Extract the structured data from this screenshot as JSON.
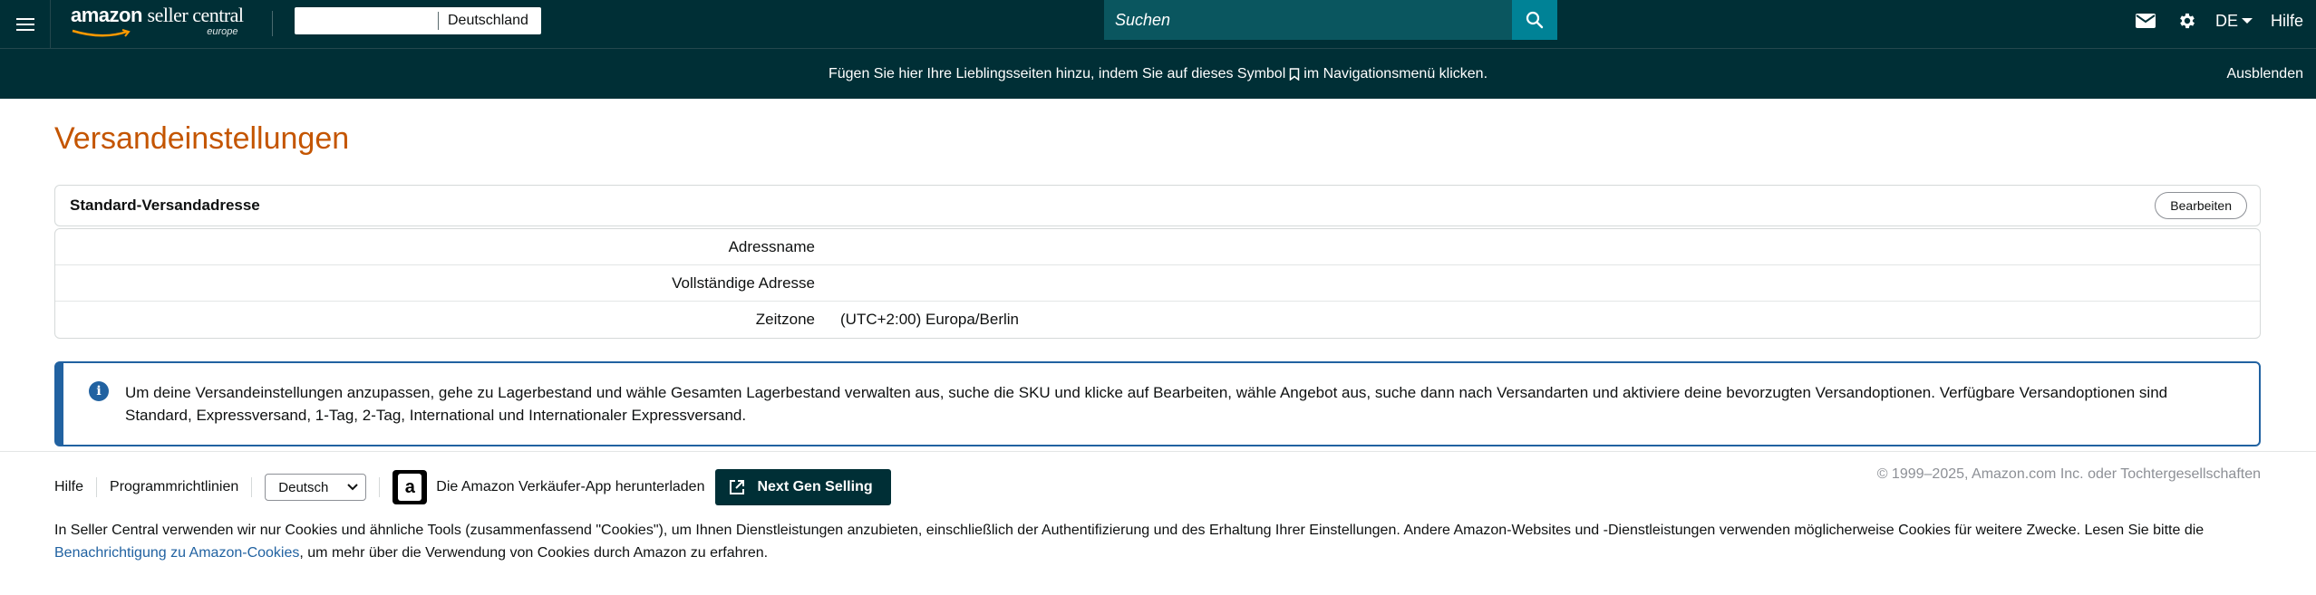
{
  "header": {
    "logo_main": "amazon",
    "logo_rest": "seller central",
    "logo_sub": "europe",
    "marketplace": "Deutschland",
    "search_placeholder": "Suchen",
    "language": "DE",
    "help": "Hilfe"
  },
  "favbar": {
    "message_before": "Fügen Sie hier Ihre Lieblingsseiten hinzu, indem Sie auf dieses Symbol",
    "message_after": "im Navigationsmenü klicken.",
    "hide": "Ausblenden"
  },
  "page": {
    "title": "Versandeinstellungen",
    "card_title": "Standard-Versandadresse",
    "edit_button": "Bearbeiten",
    "rows": [
      {
        "label": "Adressname",
        "value": ""
      },
      {
        "label": "Vollständige Adresse",
        "value": ""
      },
      {
        "label": "Zeitzone",
        "value": "(UTC+2:00) Europa/Berlin"
      }
    ],
    "info": "Um deine Versandeinstellungen anzupassen, gehe zu Lagerbestand und wähle Gesamten Lagerbestand verwalten aus, suche die SKU und klicke auf Bearbeiten, wähle Angebot aus, suche dann nach Versandarten und aktiviere deine bevorzugten Versandoptionen. Verfügbare Versandoptionen sind Standard, Expressversand, 1-Tag, 2-Tag, International und Internationaler Expressversand."
  },
  "footer": {
    "help": "Hilfe",
    "policies": "Programmrichtlinien",
    "language_select": "Deutsch",
    "app_download": "Die Amazon Verkäufer-App herunterladen",
    "next_gen": "Next Gen Selling",
    "copyright": "© 1999–2025, Amazon.com Inc. oder Tochtergesellschaften",
    "cookie_before": "In Seller Central verwenden wir nur Cookies und ähnliche Tools (zusammenfassend \"Cookies\"), um Ihnen Dienstleistungen anzubieten, einschließlich der Authentifizierung und des Erhaltung Ihrer Einstellungen. Andere Amazon-Websites und -Dienstleistungen verwenden möglicherweise Cookies für weitere Zwecke. Lesen Sie bitte die",
    "cookie_link": "Benachrichtigung zu Amazon-Cookies",
    "cookie_after": ", um mehr über die Verwendung von Cookies durch Amazon zu erfahren."
  },
  "colors": {
    "nav_bg": "#002f36",
    "title": "#c45500",
    "info_border": "#2162a1",
    "link": "#2162a1"
  },
  "icons": {
    "menu": "hamburger-icon",
    "search": "search-icon",
    "mail": "mail-icon",
    "settings": "gear-icon",
    "bookmark": "bookmark-icon",
    "info": "info-icon",
    "app": "amazon-app-icon",
    "external": "external-link-icon"
  }
}
